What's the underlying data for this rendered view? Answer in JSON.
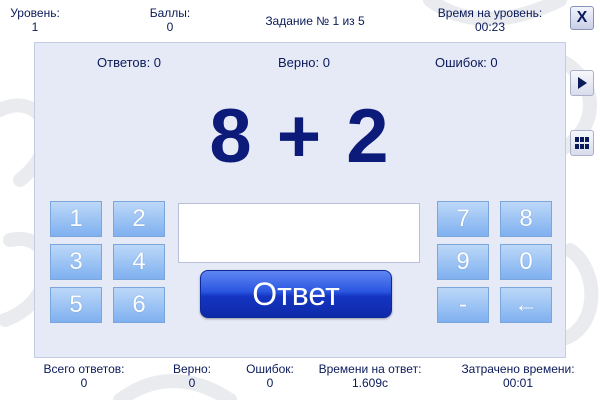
{
  "header": {
    "level": {
      "label": "Уровень:",
      "value": "1"
    },
    "points": {
      "label": "Баллы:",
      "value": "0"
    },
    "task": "Задание № 1 из 5",
    "level_time": {
      "label": "Время на уровень:",
      "value": "00:23"
    },
    "close_label": "X"
  },
  "panel": {
    "answers": "Ответов: 0",
    "correct": "Верно: 0",
    "errors": "Ошибок: 0",
    "expression": "8 + 2",
    "answer_value": "",
    "answer_button": "Ответ"
  },
  "keypad": {
    "left": [
      "1",
      "2",
      "3",
      "4",
      "5",
      "6"
    ],
    "right": [
      "7",
      "8",
      "9",
      "0",
      "-",
      "←"
    ]
  },
  "footer": {
    "total_answers": {
      "label": "Всего ответов:",
      "value": "0"
    },
    "correct": {
      "label": "Верно:",
      "value": "0"
    },
    "errors": {
      "label": "Ошибок:",
      "value": "0"
    },
    "answer_time": {
      "label": "Времени на ответ:",
      "value": "1.609с"
    },
    "time_spent": {
      "label": "Затрачено времени:",
      "value": "00:01"
    }
  },
  "icons": {
    "close": "close-icon",
    "next": "play-triangle-icon",
    "grid": "grid-icon"
  },
  "colors": {
    "accent": "#0c1a7a",
    "key": "#8fbcf2",
    "panel": "#e6e9f6",
    "answer_button": "#1d3fd0"
  }
}
